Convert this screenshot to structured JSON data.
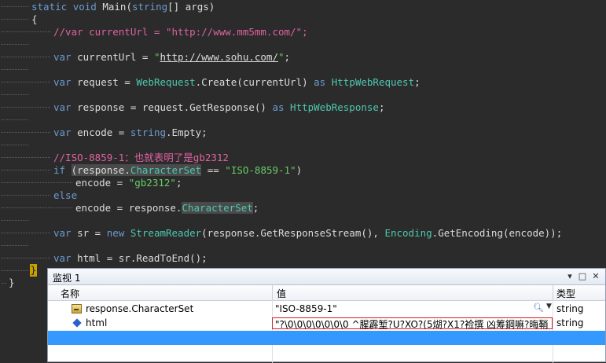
{
  "code": {
    "line1": {
      "static": "static",
      "void": "void",
      "main": "Main",
      "params_open": "(",
      "string": "string",
      "rest": "[] args)"
    },
    "line2": {
      "brace": "{"
    },
    "line3": {
      "comment": "//var currentUrl = \"http://www.mm5mm.com/\";"
    },
    "line4": {
      "var": "var",
      "name": " currentUrl = ",
      "q1": "\"",
      "url": "http://www.sohu.com/",
      "q2": "\"",
      "end": ";"
    },
    "line5": {
      "var": "var",
      "mid": " request = ",
      "type1": "WebRequest",
      "call": ".Create(currentUrl) ",
      "as": "as",
      "sp": " ",
      "type2": "HttpWebRequest",
      "end": ";"
    },
    "line6": {
      "var": "var",
      "mid": " response = request.GetResponse() ",
      "as": "as",
      "sp": " ",
      "type2": "HttpWebResponse",
      "end": ";"
    },
    "line7": {
      "var": "var",
      "mid": " encode = ",
      "string": "string",
      "end": ".Empty;"
    },
    "line8": {
      "comment": "//ISO-8859-1：也就表明了是gb2312"
    },
    "line9": {
      "if": "if",
      "sp": " ",
      "open": "(",
      "obj": "response",
      "dot": ".",
      "prop": "CharacterSet",
      "eq": " == ",
      "str": "\"ISO-8859-1\"",
      "close": ")"
    },
    "line10": {
      "mid": "encode = ",
      "str": "\"gb2312\"",
      "end": ";"
    },
    "line11": {
      "else": "else"
    },
    "line12": {
      "mid": "encode = response.",
      "prop": "CharacterSet",
      "end": ";"
    },
    "line13": {
      "var": "var",
      "mid": " sr = ",
      "new": "new",
      "sp": " ",
      "type1": "StreamReader",
      "args": "(response.GetResponseStream(), ",
      "type2": "Encoding",
      "end": ".GetEncoding(encode));"
    },
    "line14": {
      "var": "var",
      "mid": " html = sr.ReadToEnd();"
    },
    "line15": {
      "brace": "}"
    },
    "line16": {
      "brace": "}"
    }
  },
  "watch": {
    "title": "监视 1",
    "columns": {
      "name": "名称",
      "value": "值",
      "type": "类型"
    },
    "rows": [
      {
        "name": "response.CharacterSet",
        "value": "\"ISO-8859-1\"",
        "type": "string"
      },
      {
        "name": "html",
        "value": "\"?\\0\\0\\0\\0\\0\\0\\0 ^腥霹堑?U?XO?(5煳?X1?裣撰  凶筹鋼嘛?晦鞘 ...",
        "type": "string"
      }
    ],
    "buttons": {
      "dropdown": "▾",
      "maximize": "□",
      "close": "✕"
    }
  },
  "icons": {
    "property": "property-icon",
    "field": "field-icon",
    "magnifier": "magnifier-icon",
    "dropdown": "chevron-down-icon"
  },
  "colors": {
    "editor_bg": "#2b2b2b",
    "keyword": "#6c9bd2",
    "type": "#4ec9b0",
    "string": "#66cc66",
    "comment": "#e062a3",
    "selection": "#3399ff",
    "error_box": "#d02020"
  }
}
